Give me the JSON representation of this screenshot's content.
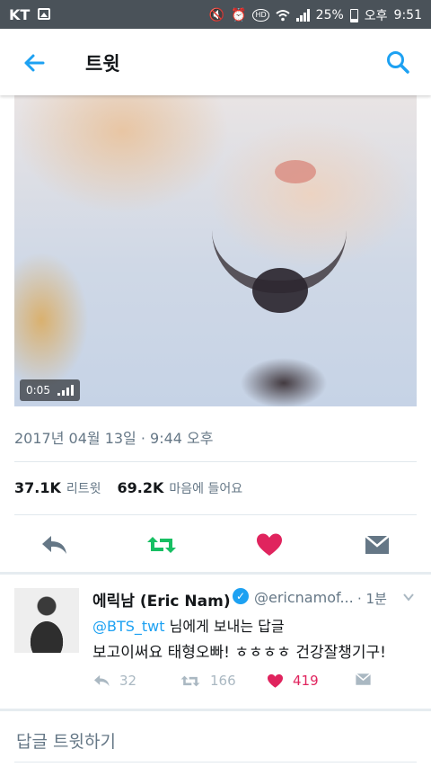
{
  "status_bar": {
    "carrier": "KT",
    "battery": "25%",
    "ampm": "오후",
    "time": "9:51"
  },
  "app_bar": {
    "title": "트윗"
  },
  "video": {
    "duration": "0:05"
  },
  "tweet": {
    "timestamp": "2017년 04월 13일 · 9:44 오후",
    "retweet_count": "37.1K",
    "retweet_label": "리트윗",
    "like_count": "69.2K",
    "like_label": "마음에 들어요"
  },
  "reply": {
    "name": "에릭남 (Eric Nam)",
    "handle": "@ericnamof...",
    "time": "· 1분",
    "mention": "@BTS_twt",
    "replying_to_suffix": " 님에게 보내는 답글",
    "text": "보고이써요 태형오빠! ㅎㅎㅎㅎ 건강잘챙기구!",
    "reply_count": "32",
    "retweet_count": "166",
    "like_count": "419"
  },
  "compose": {
    "placeholder": "답글 트윗하기"
  },
  "colors": {
    "accent": "#1da1f2",
    "retweet_green": "#17bf63",
    "like_red": "#e0245e",
    "status_bar": "#4a5259"
  },
  "icons": [
    "back-arrow-icon",
    "search-icon",
    "reply-icon",
    "retweet-icon",
    "heart-icon",
    "dm-icon",
    "verified-icon",
    "chevron-down-icon"
  ]
}
